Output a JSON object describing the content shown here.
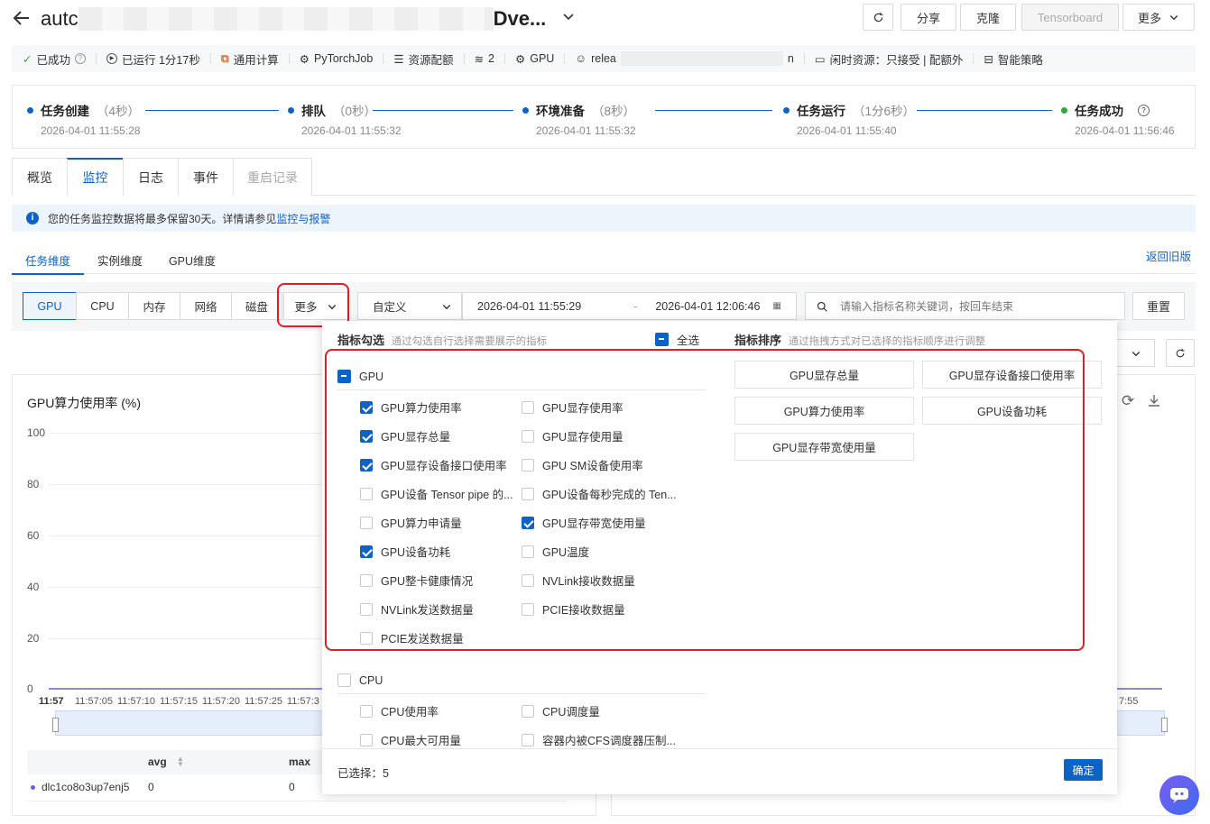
{
  "header": {
    "title_prefix": "autc",
    "title_suffix": "Dve...",
    "refresh_label": "↻",
    "share_label": "分享",
    "clone_label": "克隆",
    "tensorboard_label": "Tensorboard",
    "more_label": "更多"
  },
  "meta": {
    "status": "已成功",
    "runtime": "已运行 1分17秒",
    "compute": "通用计算",
    "job_type": "PyTorchJob",
    "quota": "资源配额",
    "nodes": "2",
    "resource": "GPU",
    "release": "relea",
    "release_tail": "n",
    "idle": "闲时资源：只接受 | 配额外",
    "strategy": "智能策略"
  },
  "steps": [
    {
      "name": "任务创建",
      "dur": "（4秒）",
      "time": "2026-04-01 11:55:28"
    },
    {
      "name": "排队",
      "dur": "（0秒）",
      "time": "2026-04-01 11:55:32"
    },
    {
      "name": "环境准备",
      "dur": "（8秒）",
      "time": "2026-04-01 11:55:32"
    },
    {
      "name": "任务运行",
      "dur": "（1分6秒）",
      "time": "2026-04-01 11:55:40"
    },
    {
      "name": "任务成功",
      "dur": "",
      "time": "2026-04-01 11:56:46"
    }
  ],
  "tabs": [
    "概览",
    "监控",
    "日志",
    "事件",
    "重启记录"
  ],
  "notice": {
    "text": "您的任务监控数据将最多保留30天。详情请参见",
    "link": "监控与报警"
  },
  "subtabs": [
    "任务维度",
    "实例维度",
    "GPU维度"
  ],
  "back_old": "返回旧版",
  "filters": {
    "segments": [
      "GPU",
      "CPU",
      "内存",
      "网络",
      "磁盘"
    ],
    "more": "更多",
    "range_type": "自定义",
    "start": "2026-04-01 11:55:29",
    "range_sep": "-",
    "end": "2026-04-01 12:06:46",
    "search_placeholder": "请输入指标名称关键词，按回车结束",
    "reset": "重置"
  },
  "chart": {
    "title": "GPU算力使用率 (%)",
    "yticks": [
      "100",
      "80",
      "60",
      "40",
      "20",
      "0"
    ],
    "xticks": [
      "11:57",
      "11:57:05",
      "11:57:10",
      "11:57:15",
      "11:57:20",
      "11:57:25",
      "11:57:3"
    ],
    "xtick_right": "7:55",
    "table_headers": [
      "avg",
      "max"
    ],
    "row": {
      "name": "dlc1co8o3up7enj5",
      "avg": "0",
      "max": "0"
    }
  },
  "chart_data": {
    "type": "line",
    "title": "GPU算力使用率 (%)",
    "ylim": [
      0,
      100
    ],
    "x": [
      "11:57",
      "11:57:05",
      "11:57:10",
      "11:57:15",
      "11:57:20",
      "11:57:25",
      "11:57:3"
    ],
    "series": [
      {
        "name": "dlc1co8o3up7enj5",
        "values": [
          0,
          0,
          0,
          0,
          0,
          0,
          0
        ]
      }
    ]
  },
  "popup": {
    "pick_title": "指标勾选",
    "pick_hint": "通过勾选自行选择需要展示的指标",
    "select_all": "全选",
    "sort_title": "指标排序",
    "sort_hint": "通过拖拽方式对已选择的指标顺序进行调整",
    "group_gpu": "GPU",
    "group_cpu": "CPU",
    "gpu_left": [
      {
        "label": "GPU算力使用率",
        "checked": true
      },
      {
        "label": "GPU显存总量",
        "checked": true
      },
      {
        "label": "GPU显存设备接口使用率",
        "checked": true
      },
      {
        "label": "GPU设备 Tensor pipe 的...",
        "checked": false
      },
      {
        "label": "GPU算力申请量",
        "checked": false
      },
      {
        "label": "GPU设备功耗",
        "checked": true
      },
      {
        "label": "GPU整卡健康情况",
        "checked": false
      },
      {
        "label": "NVLink发送数据量",
        "checked": false
      },
      {
        "label": "PCIE发送数据量",
        "checked": false
      }
    ],
    "gpu_right": [
      {
        "label": "GPU显存使用率",
        "checked": false
      },
      {
        "label": "GPU显存使用量",
        "checked": false
      },
      {
        "label": "GPU SM设备使用率",
        "checked": false
      },
      {
        "label": "GPU设备每秒完成的 Ten...",
        "checked": false
      },
      {
        "label": "GPU显存带宽使用量",
        "checked": true
      },
      {
        "label": "GPU温度",
        "checked": false
      },
      {
        "label": "NVLink接收数据量",
        "checked": false
      },
      {
        "label": "PCIE接收数据量",
        "checked": false
      }
    ],
    "cpu_left": [
      {
        "label": "CPU使用率",
        "checked": false
      },
      {
        "label": "CPU最大可用量",
        "checked": false
      }
    ],
    "cpu_right": [
      {
        "label": "CPU调度量",
        "checked": false
      },
      {
        "label": "容器内被CFS调度器压制...",
        "checked": false
      }
    ],
    "sort_items": [
      "GPU显存总量",
      "GPU显存设备接口使用率",
      "GPU算力使用率",
      "GPU设备功耗",
      "GPU显存带宽使用量"
    ],
    "selected_label": "已选择：",
    "selected_count": "5",
    "confirm": "确定"
  },
  "colors": {
    "accent": "#0b63c6",
    "success": "#2faa3b",
    "highlight": "#e02020",
    "series": "#6c5ce7"
  }
}
